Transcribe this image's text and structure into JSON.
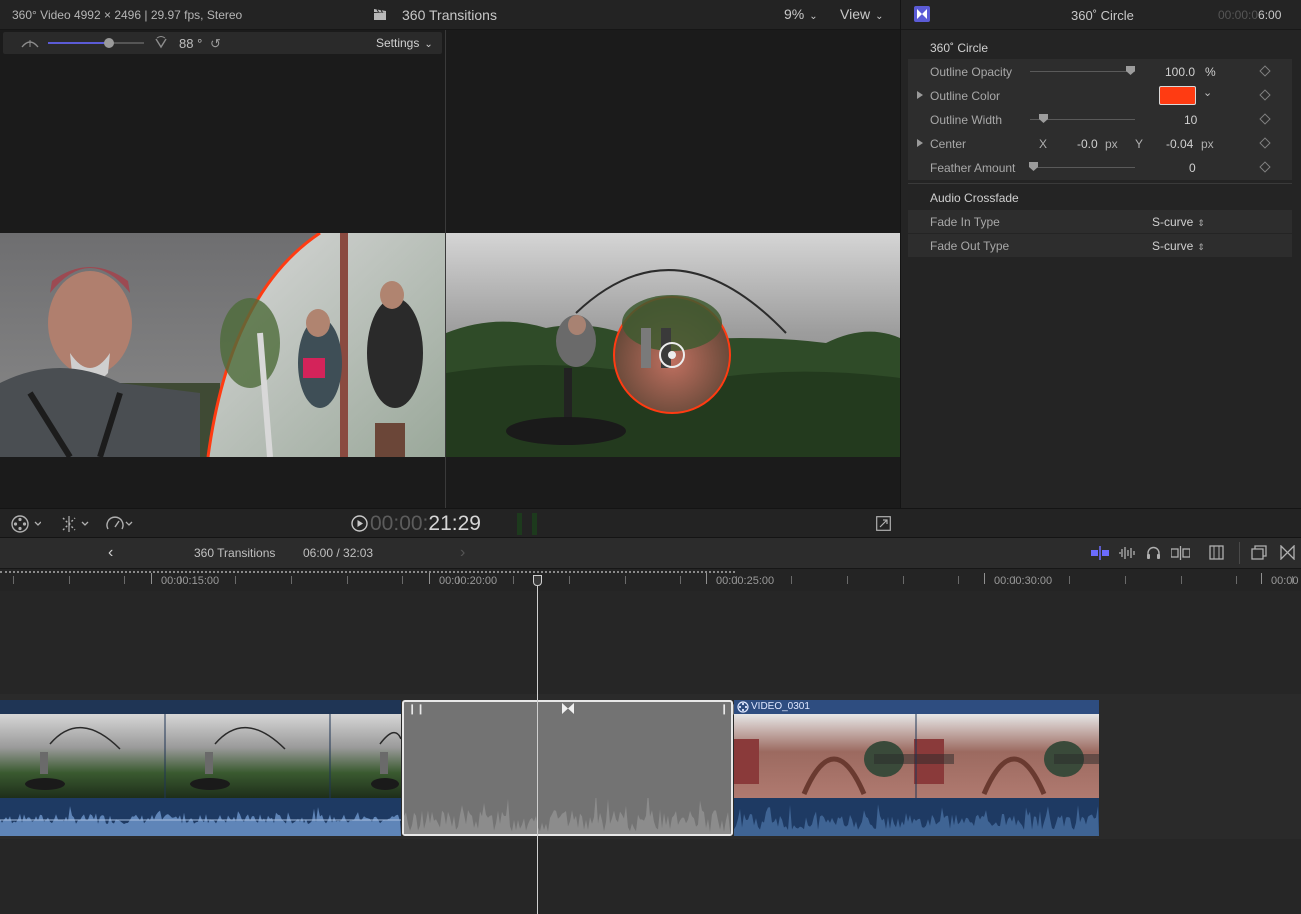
{
  "viewer_top": {
    "format_info": "360° Video 4992 × 2496 | 29.97 fps, Stereo",
    "title": "360 Transitions",
    "zoom": "9%",
    "view_menu": "View"
  },
  "viewer_360": {
    "fov_value": "88 °",
    "settings_label": "Settings"
  },
  "inspector": {
    "title": "360˚ Circle",
    "timecode_dim": "00:00:0",
    "timecode_bright": "6:00",
    "section_title": "360˚ Circle",
    "params": [
      {
        "label": "Outline Opacity",
        "value": "100.0",
        "unit": "%",
        "slider_level": 0.97
      },
      {
        "label": "Outline Color"
      },
      {
        "label": "Outline Width",
        "value": "10",
        "slider_level": 0.1
      },
      {
        "label": "Center",
        "x_label": "X",
        "x_value": "-0.0",
        "x_unit": "px",
        "y_label": "Y",
        "y_value": "-0.04",
        "y_unit": "px"
      },
      {
        "label": "Feather Amount",
        "value": "0",
        "slider_level": 0.0
      }
    ],
    "outline_color_hex": "#ff3b12",
    "audio_section": "Audio Crossfade",
    "fade_in_label": "Fade In Type",
    "fade_in_value": "S-curve",
    "fade_out_label": "Fade Out Type",
    "fade_out_value": "S-curve"
  },
  "controls": {
    "timecode_dim": "00:00:",
    "timecode_bright": "21:29"
  },
  "timeline_bar": {
    "project_name": "360 Transitions",
    "duration": "06:00 / 32:03"
  },
  "ruler": {
    "labels": [
      "00:00:15:00",
      "00:00:20:00",
      "00:00:25:00",
      "00:00:30:00",
      "00:00"
    ]
  },
  "clips": {
    "right_clip_name": "VIDEO_0301"
  },
  "colors": {
    "accent": "#5b5bd6",
    "clip_blue": "#1f3555",
    "outline_red": "#ff3b12"
  }
}
